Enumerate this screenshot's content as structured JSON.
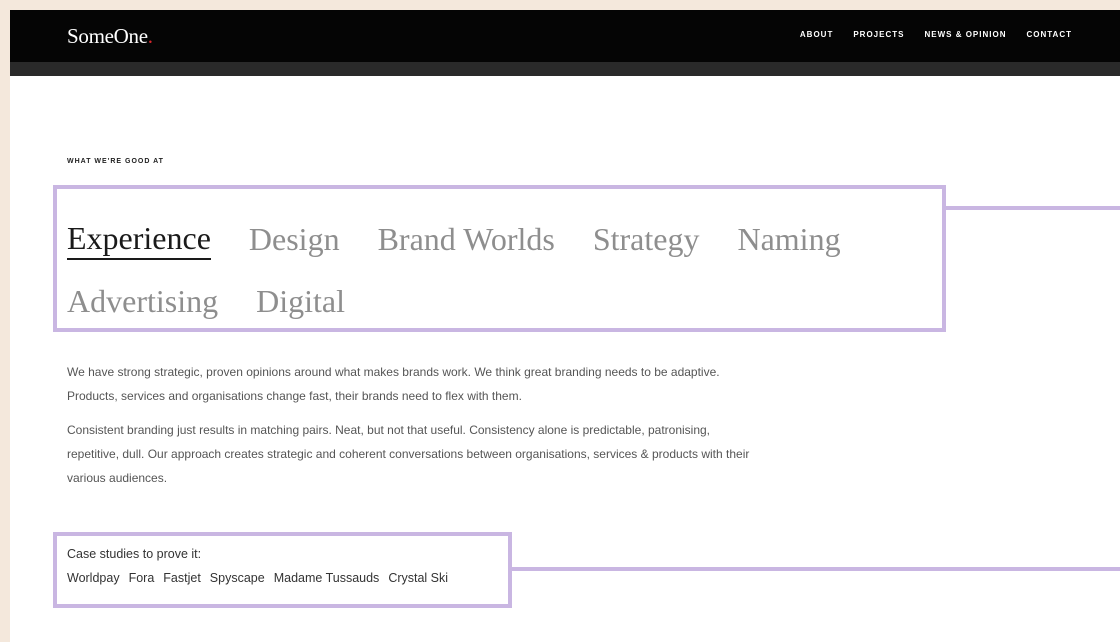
{
  "header": {
    "logo_text": "SomeOne",
    "logo_dot": ".",
    "nav": [
      "ABOUT",
      "PROJECTS",
      "NEWS & OPINION",
      "CONTACT"
    ]
  },
  "section": {
    "eyebrow": "WHAT WE'RE GOOD AT",
    "disciplines_row1": [
      "Experience",
      "Design",
      "Brand Worlds",
      "Strategy",
      "Naming"
    ],
    "disciplines_row2": [
      "Advertising",
      "Digital"
    ],
    "active_discipline": "Experience"
  },
  "copy": {
    "p1": "We have strong strategic, proven opinions around what makes brands work. We think great branding needs to be adaptive. Products, services and organisations change fast, their brands need to flex with them.",
    "p2": "Consistent branding just results in matching pairs. Neat, but not that useful. Consistency alone is predictable, patronising, repetitive, dull. Our approach creates strategic and coherent conversations between organisations, services & products with their various audiences."
  },
  "case_studies": {
    "label": "Case studies to prove it:",
    "links": [
      "Worldpay",
      "Fora",
      "Fastjet",
      "Spyscape",
      "Madame Tussauds",
      "Crystal Ski"
    ]
  },
  "colors": {
    "highlight": "#c9b6e2",
    "logo_dot": "#d8262c",
    "page_bg": "#f4e8dc"
  }
}
